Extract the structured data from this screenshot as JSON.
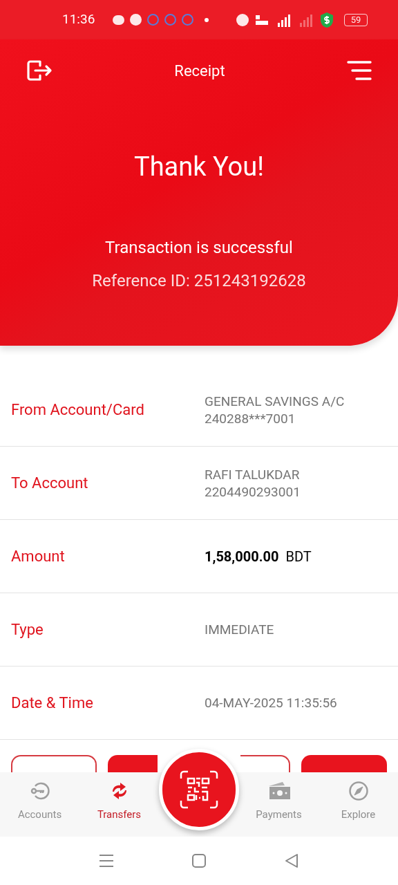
{
  "status_bar": {
    "time": "11:36",
    "battery": "59"
  },
  "header": {
    "title": "Receipt",
    "heading": "Thank You!",
    "message": "Transaction is successful",
    "reference": "Reference ID: 251243192628"
  },
  "details": [
    {
      "label": "From Account/Card",
      "lines": [
        "GENERAL SAVINGS A/C",
        "240288***7001"
      ],
      "kind": "plain"
    },
    {
      "label": "To Account",
      "lines": [
        "RAFI TALUKDAR",
        "2204490293001"
      ],
      "kind": "plain"
    },
    {
      "label": "Amount",
      "lines": [
        "1,58,000.00",
        "BDT"
      ],
      "kind": "amount"
    },
    {
      "label": "Type",
      "lines": [
        "IMMEDIATE"
      ],
      "kind": "plain"
    },
    {
      "label": "Date & Time",
      "lines": [
        "04-MAY-2025 11:35:56"
      ],
      "kind": "plain"
    }
  ],
  "action_buttons": [
    {
      "kind": "outline"
    },
    {
      "kind": "filled"
    },
    {
      "kind": "outline"
    },
    {
      "kind": "filled"
    }
  ],
  "bottom_nav": [
    {
      "label": "Accounts",
      "kind": "tab",
      "selected": false
    },
    {
      "label": "Transfers",
      "kind": "tab",
      "selected": true
    },
    {
      "kind": "center"
    },
    {
      "label": "Payments",
      "kind": "tab",
      "selected": false
    },
    {
      "label": "Explore",
      "kind": "tab",
      "selected": false
    }
  ]
}
